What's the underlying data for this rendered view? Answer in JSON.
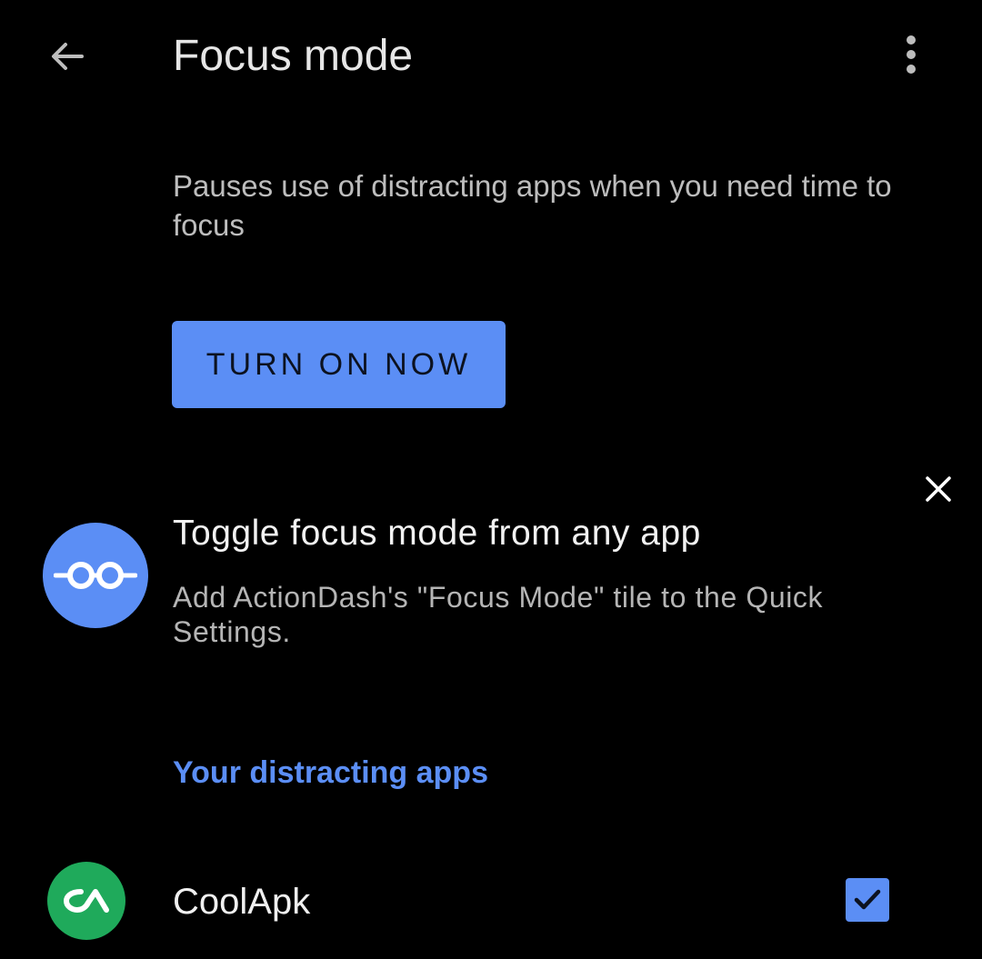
{
  "app_bar": {
    "title": "Focus mode",
    "back_icon": "arrow-left-icon",
    "overflow_icon": "more-vert-icon"
  },
  "description": "Pauses use of distracting apps when you need time to focus",
  "primary_action": {
    "label": "TURN ON NOW"
  },
  "tip_card": {
    "icon": "glasses-icon",
    "title": "Toggle focus mode from any app",
    "body": "Add ActionDash's \"Focus Mode\" tile to the Quick Settings.",
    "dismiss_icon": "close-icon"
  },
  "distracting_apps": {
    "header": "Your distracting apps",
    "items": [
      {
        "name": "CoolApk",
        "icon": "coolapk-logo-icon",
        "checked": true
      }
    ]
  },
  "colors": {
    "background": "#000000",
    "accent": "#5b8ef5",
    "app_icon_green": "#1faa5b",
    "primary_text": "#e6e6e6",
    "secondary_text": "#bdbdbd"
  }
}
